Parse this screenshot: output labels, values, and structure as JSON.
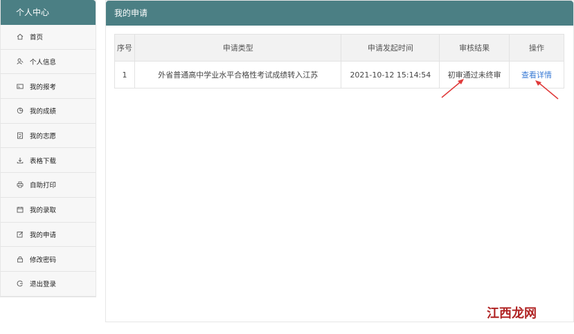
{
  "sidebar": {
    "title": "个人中心",
    "items": [
      {
        "label": "首页",
        "icon": "home-icon"
      },
      {
        "label": "个人信息",
        "icon": "user-icon"
      },
      {
        "label": "我的报考",
        "icon": "card-icon"
      },
      {
        "label": "我的成绩",
        "icon": "pie-chart-icon"
      },
      {
        "label": "我的志愿",
        "icon": "clipboard-icon"
      },
      {
        "label": "表格下载",
        "icon": "download-icon"
      },
      {
        "label": "自助打印",
        "icon": "printer-icon"
      },
      {
        "label": "我的录取",
        "icon": "calendar-icon"
      },
      {
        "label": "我的申请",
        "icon": "edit-icon"
      },
      {
        "label": "修改密码",
        "icon": "lock-icon"
      },
      {
        "label": "退出登录",
        "icon": "logout-icon"
      }
    ]
  },
  "main": {
    "title": "我的申请",
    "table": {
      "headers": [
        "序号",
        "申请类型",
        "申请发起时间",
        "审核结果",
        "操作"
      ],
      "rows": [
        {
          "index": "1",
          "type": "外省普通高中学业水平合格性考试成绩转入江苏",
          "time": "2021-10-12 15:14:54",
          "result": "初审通过未终审",
          "action": "查看详情"
        }
      ]
    }
  },
  "watermark": "江西龙网",
  "colors": {
    "header": "#4b7f84",
    "link": "#3a7bd5",
    "arrow": "#e03a3a"
  }
}
